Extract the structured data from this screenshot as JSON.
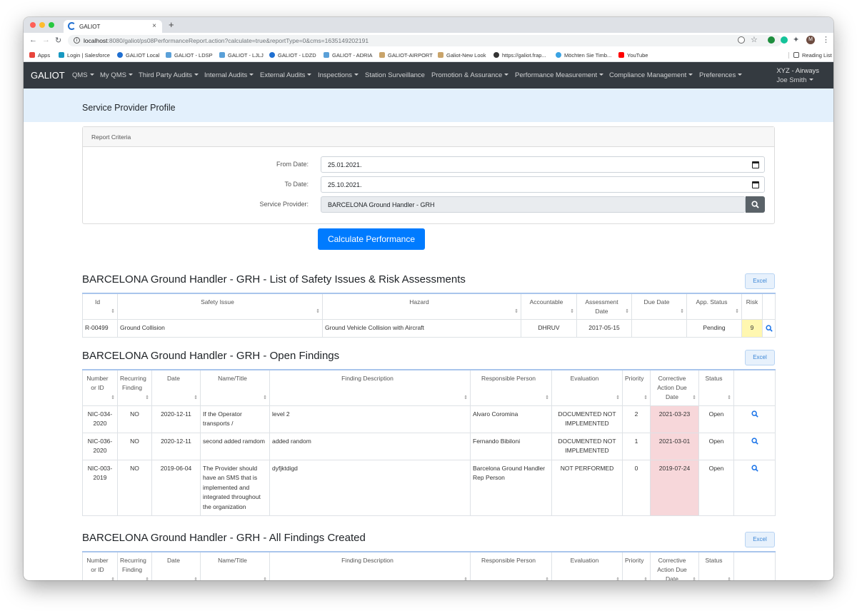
{
  "browser": {
    "tab_title": "GALIOT",
    "url_host": "localhost",
    "url_path": ":8080/galiot/ps08PerformanceReport.action?calculate=true&reportType=0&cms=1635149202191",
    "bookmarks": [
      "Apps",
      "Login | Salesforce",
      "GALIOT Local",
      "GALIOT - LDSP",
      "GALIOT - LJLJ",
      "GALIOT - LDZD",
      "GALIOT - ADRIA",
      "GALIOT-AIRPORT",
      "Galiot-New Look",
      "https://galiot.frap...",
      "Möchten Sie Timb...",
      "YouTube"
    ],
    "reading_list": "Reading List",
    "profile_initial": "M"
  },
  "navbar": {
    "brand": "GALIOT",
    "items": [
      "QMS",
      "My QMS",
      "Third Party Audits",
      "Internal Audits",
      "External Audits",
      "Inspections",
      "Station Surveillance",
      "Promotion & Assurance",
      "Performance Measurement",
      "Compliance Management",
      "Preferences"
    ],
    "org": "XYZ - Airways",
    "user": "Joe Smith"
  },
  "page": {
    "title": "Service Provider Profile"
  },
  "criteria": {
    "header": "Report Criteria",
    "from_label": "From Date:",
    "from_value": "25.01.2021.",
    "to_label": "To Date:",
    "to_value": "25.10.2021.",
    "provider_label": "Service Provider:",
    "provider_value": "BARCELONA Ground Handler - GRH",
    "calculate_label": "Calculate Performance"
  },
  "excel_label": "Excel",
  "safety": {
    "title": "BARCELONA Ground Handler - GRH - List of Safety Issues & Risk Assessments",
    "headers": [
      "Id",
      "Safety Issue",
      "Hazard",
      "Accountable",
      "Assessment Date",
      "Due Date",
      "App. Status",
      "Risk"
    ],
    "rows": [
      {
        "id": "R-00499",
        "issue": "Ground Collision",
        "hazard": "Ground Vehicle Collision with Aircraft",
        "accountable": "DHRUV",
        "date": "2017-05-15",
        "due": "",
        "status": "Pending",
        "risk": "9"
      }
    ]
  },
  "open_findings": {
    "title": "BARCELONA Ground Handler - GRH - Open Findings",
    "headers": [
      "Number or ID",
      "Recurring Finding",
      "Date",
      "Name/Title",
      "Finding Description",
      "Responsible Person",
      "Evaluation",
      "Priority",
      "Corrective Action Due Date",
      "Status"
    ],
    "rows": [
      {
        "num": "NIC-034-2020",
        "rec": "NO",
        "date": "2020-12-11",
        "name": "If the Operator transports /",
        "desc": "level 2",
        "person": "Alvaro Coromina",
        "eval": "DOCUMENTED NOT IMPLEMENTED",
        "prio": "2",
        "due": "2021-03-23",
        "status": "Open"
      },
      {
        "num": "NIC-036-2020",
        "rec": "NO",
        "date": "2020-12-11",
        "name": "second added ramdom",
        "desc": "added random",
        "person": "Fernando Bibiloni",
        "eval": "DOCUMENTED NOT IMPLEMENTED",
        "prio": "1",
        "due": "2021-03-01",
        "status": "Open"
      },
      {
        "num": "NIC-003-2019",
        "rec": "NO",
        "date": "2019-06-04",
        "name": "The Provider should have an SMS that is implemented and integrated throughout the organization",
        "desc": "dyfjktdigd",
        "person": "Barcelona Ground Handler Rep Person",
        "eval": "NOT PERFORMED",
        "prio": "0",
        "due": "2019-07-24",
        "status": "Open"
      }
    ]
  },
  "all_findings": {
    "title": "BARCELONA Ground Handler - GRH - All Findings Created",
    "headers": [
      "Number or ID",
      "Recurring Finding",
      "Date",
      "Name/Title",
      "Finding Description",
      "Responsible Person",
      "Evaluation",
      "Priority",
      "Corrective Action Due Date",
      "Status"
    ]
  },
  "colors": {
    "navbar": "#343a40",
    "primary": "#007bff",
    "banner": "#e3f0fc",
    "due_cell": "#f7d7da",
    "risk_cell": "#fff7b0"
  }
}
